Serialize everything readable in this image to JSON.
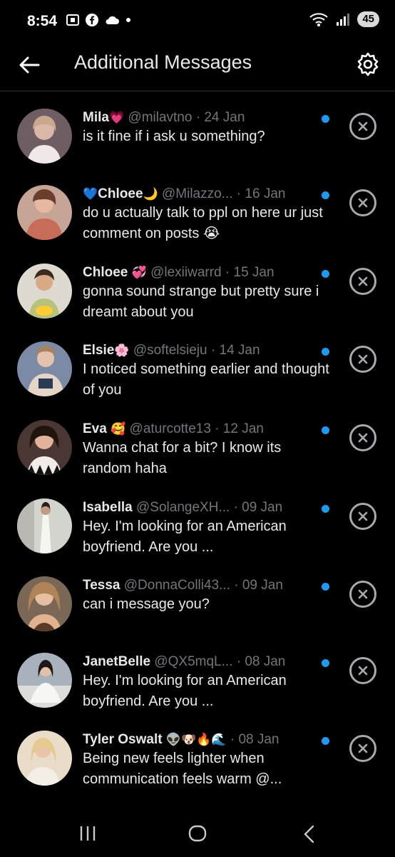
{
  "status_bar": {
    "time": "8:54",
    "battery": "45"
  },
  "header": {
    "title": "Additional Messages"
  },
  "messages": [
    {
      "name": "Mila",
      "emoji": "💗",
      "handle": "@milavtno",
      "separator": "·",
      "date": "24 Jan",
      "preview": "is it fine if i ask u something?",
      "avatar_color": "#7a6a6e"
    },
    {
      "name_prefix": "💙",
      "name": "Chloee",
      "emoji": "🌙",
      "handle": "@Milazzo...",
      "separator": "·",
      "date": "16 Jan",
      "preview": "do u actually talk to ppl on here ur just comment on posts 😭",
      "avatar_color": "#b77c6a"
    },
    {
      "name": "Chloee",
      "emoji": "💞",
      "handle": "@lexiiwarrd",
      "separator": "·",
      "date": "15 Jan",
      "preview": "gonna sound strange but pretty sure i dreamt about you",
      "avatar_color": "#8a7a5c"
    },
    {
      "name": "Elsie",
      "emoji": "🌸",
      "handle": "@softelsieju",
      "separator": "·",
      "date": "14 Jan",
      "preview": "I noticed something earlier and thought of you",
      "avatar_color": "#6f7fa0"
    },
    {
      "name": "Eva",
      "emoji": "🥰",
      "handle": "@aturcotte13",
      "separator": "·",
      "date": "12 Jan",
      "preview": "Wanna chat for a bit? I know its random haha",
      "avatar_color": "#5a3f3a"
    },
    {
      "name": "Isabella",
      "emoji": "",
      "handle": "@SolangeXH...",
      "separator": "·",
      "date": "09 Jan",
      "preview": "Hey. I'm looking for an American boyfriend. Are you ...",
      "avatar_color": "#c9c9c4"
    },
    {
      "name": "Tessa",
      "emoji": "",
      "handle": "@DonnaColli43...",
      "separator": "·",
      "date": "09 Jan",
      "preview": "can i message you?",
      "avatar_color": "#8b6a52"
    },
    {
      "name": "JanetBelle",
      "emoji": "",
      "handle": "@QX5mqL...",
      "separator": "·",
      "date": "08 Jan",
      "preview": "Hey. I'm looking for an American boyfriend. Are you ...",
      "avatar_color": "#9aa3ad"
    },
    {
      "name": "Tyler Oswalt",
      "emoji": "👽🐶🔥🌊",
      "handle": "",
      "separator": "·",
      "date": "08 Jan",
      "preview": "Being new feels lighter when communication feels warm @...",
      "avatar_color": "#c7a98b"
    }
  ],
  "colors": {
    "accent": "#1d9bf0",
    "background": "#000000",
    "muted": "#71767b"
  },
  "icons": {
    "back": "arrow-left-icon",
    "settings": "gear-icon",
    "dismiss": "close-circle-icon",
    "unread": "unread-dot-icon"
  }
}
